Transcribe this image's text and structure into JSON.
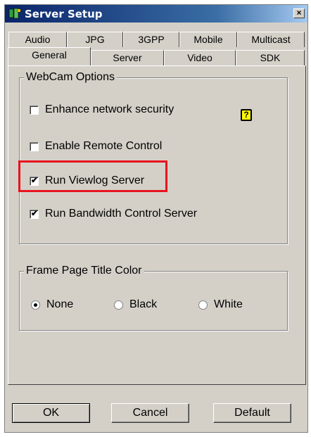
{
  "window": {
    "title": "Server Setup",
    "close_glyph": "×"
  },
  "tabs_top": [
    {
      "label": "Audio"
    },
    {
      "label": "JPG"
    },
    {
      "label": "3GPP"
    },
    {
      "label": "Mobile"
    },
    {
      "label": "Multicast"
    }
  ],
  "tabs_bottom": [
    {
      "label": "General",
      "active": true
    },
    {
      "label": "Server"
    },
    {
      "label": "Video"
    },
    {
      "label": "SDK"
    }
  ],
  "webcam_options": {
    "title": "WebCam Options",
    "help_glyph": "?",
    "options": [
      {
        "label": "Enhance network security",
        "checked": false
      },
      {
        "label": "Enable Remote Control",
        "checked": false
      },
      {
        "label": "Run Viewlog Server",
        "checked": true,
        "highlighted": true
      },
      {
        "label": "Run Bandwidth Control Server",
        "checked": true
      }
    ]
  },
  "frame_color": {
    "title": "Frame Page Title Color",
    "options": [
      {
        "label": "None",
        "selected": true
      },
      {
        "label": "Black",
        "selected": false
      },
      {
        "label": "White",
        "selected": false
      }
    ]
  },
  "buttons": {
    "ok": "OK",
    "cancel": "Cancel",
    "default": "Default"
  },
  "colors": {
    "highlight": "#e8141e",
    "help_icon": "#ffff00",
    "titlebar": "#0a246a"
  },
  "check_glyph": "✔"
}
